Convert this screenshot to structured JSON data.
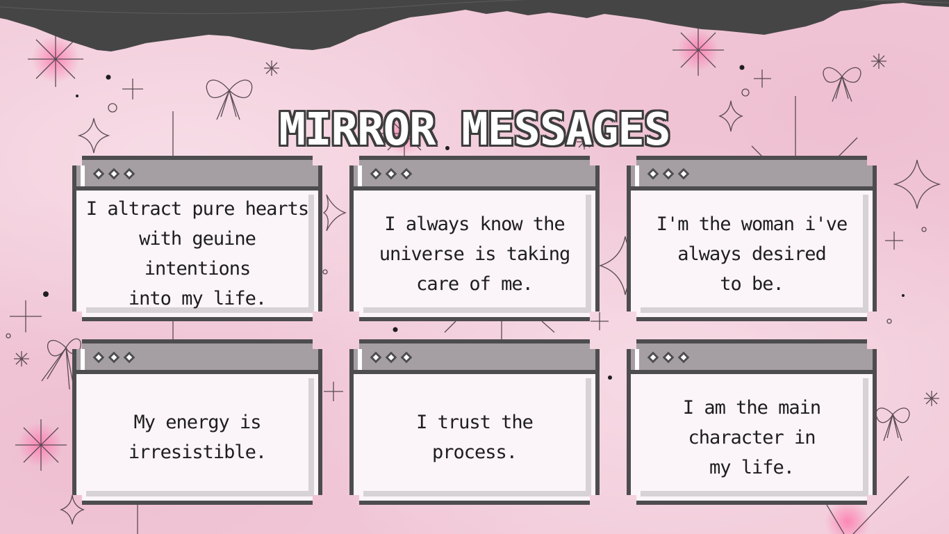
{
  "title": "MIRROR MESSAGES",
  "colors": {
    "background": "#f2cad9",
    "torn_paper": "#454545",
    "window_border": "#4d4c4f",
    "title_bar": "#a59ea3",
    "window_body": "#fbf4f8"
  },
  "windows": [
    {
      "message": "I altract pure hearts\nwith geuine intentions\ninto my life."
    },
    {
      "message": "I always know the\nuniverse is taking\ncare of me."
    },
    {
      "message": "I'm the woman i've\nalways desired\nto be."
    },
    {
      "message": "My energy is\nirresistible."
    },
    {
      "message": "I trust the\nprocess."
    },
    {
      "message": "I am the main\ncharacter in\nmy life."
    }
  ],
  "decorations": [
    "torn-paper",
    "sparkle-icon",
    "bow-icon",
    "star-icon",
    "dot"
  ]
}
